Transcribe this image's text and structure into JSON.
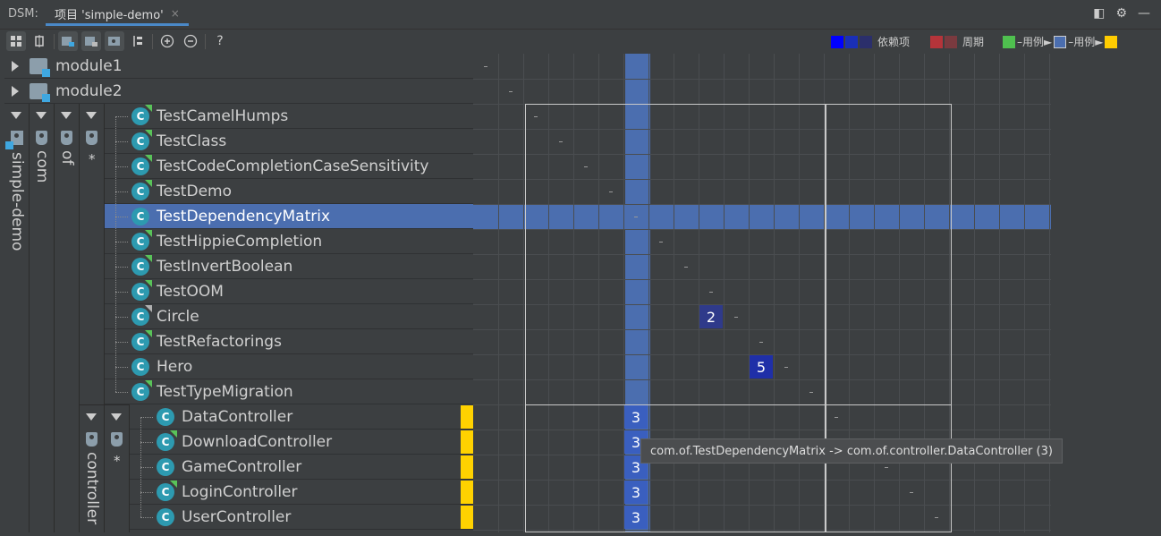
{
  "window": {
    "dsm_label": "DSM:",
    "tab_label": "项目 'simple-demo'",
    "tab_close": "×"
  },
  "window_icons": [
    "◧",
    "⚙",
    "—"
  ],
  "toolbar": {
    "help_label": "?"
  },
  "legend": {
    "dependency_label": "依赖项",
    "dependency_colors": [
      "#0000ff",
      "#1a2fb8",
      "#2b2f6b"
    ],
    "cycle_label": "周期",
    "cycle_colors": [
      "#b5343a",
      "#7a3a3f"
    ],
    "usage_label_1": "–用例►",
    "usage_color_1": "#4fc04f",
    "usage_label_2": "–用例►",
    "usage_color_2": "#ffcc00",
    "selected_color": "#4b6eaf"
  },
  "modules": [
    {
      "name": "module1"
    },
    {
      "name": "module2"
    }
  ],
  "hierarchy": {
    "root": "simple-demo",
    "level1": "com",
    "level2": "of",
    "level3_star": "*",
    "controller": "controller",
    "controller_star": "*"
  },
  "classes": [
    {
      "name": "TestCamelHumps",
      "tag": "green"
    },
    {
      "name": "TestClass",
      "tag": "green"
    },
    {
      "name": "TestCodeCompletionCaseSensitivity",
      "tag": "green"
    },
    {
      "name": "TestDemo",
      "tag": "green"
    },
    {
      "name": "TestDependencyMatrix",
      "tag": "none",
      "selected": true
    },
    {
      "name": "TestHippieCompletion",
      "tag": "green"
    },
    {
      "name": "TestInvertBoolean",
      "tag": "green"
    },
    {
      "name": "TestOOM",
      "tag": "green"
    },
    {
      "name": "Circle",
      "tag": "grey"
    },
    {
      "name": "TestRefactorings",
      "tag": "green"
    },
    {
      "name": "Hero",
      "tag": "none"
    },
    {
      "name": "TestTypeMigration",
      "tag": "green"
    }
  ],
  "controllers": [
    {
      "name": "DataController",
      "tag": "none"
    },
    {
      "name": "DownloadController",
      "tag": "green"
    },
    {
      "name": "GameController",
      "tag": "none"
    },
    {
      "name": "LoginController",
      "tag": "green"
    },
    {
      "name": "UserController",
      "tag": "none"
    }
  ],
  "matrix_cells": [
    {
      "row": 10,
      "col": 9,
      "value": "2",
      "color": "#2f3a8a"
    },
    {
      "row": 12,
      "col": 11,
      "value": "5",
      "color": "#1f2fa8"
    },
    {
      "row": 14,
      "col": 6,
      "value": "3",
      "color": "#3a5fbf"
    },
    {
      "row": 15,
      "col": 6,
      "value": "3",
      "color": "#3a5fbf"
    },
    {
      "row": 16,
      "col": 6,
      "value": "3",
      "color": "#3a5fbf"
    },
    {
      "row": 17,
      "col": 6,
      "value": "3",
      "color": "#3a5fbf"
    },
    {
      "row": 18,
      "col": 6,
      "value": "3",
      "color": "#3a5fbf"
    }
  ],
  "tooltip": "com.of.TestDependencyMatrix -> com.of.controller.DataController (3)"
}
